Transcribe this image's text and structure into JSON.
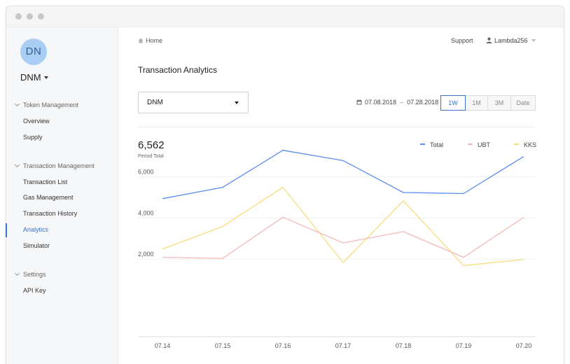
{
  "sidebar": {
    "avatar_initials": "DN",
    "org_name": "DNM",
    "sections": [
      {
        "label": "Token Management",
        "items": [
          "Overview",
          "Supply"
        ]
      },
      {
        "label": "Transaction Management",
        "items": [
          "Transaction List",
          "Gas Management",
          "Transaction History",
          "Analytics",
          "Simulator"
        ]
      },
      {
        "label": "Settings",
        "items": [
          "API Key"
        ]
      }
    ],
    "active_item": "Analytics"
  },
  "header": {
    "breadcrumb": "Home",
    "support": "Support",
    "username": "Lambda256"
  },
  "main": {
    "title": "Transaction Analytics",
    "token_select": "DNM",
    "date_start": "07.08.2018",
    "date_sep": "–",
    "date_end": "07.28.2018",
    "range_buttons": [
      "1W",
      "1M",
      "3M",
      "Date"
    ],
    "active_range": "1W",
    "period_total": "6,562",
    "period_total_label": "Period Total"
  },
  "colors": {
    "accent": "#3b72c9",
    "total": "#5b8def",
    "ubt": "#f3b9b9",
    "kks": "#f8dc7a"
  },
  "chart_data": {
    "type": "line",
    "x": [
      "07.14",
      "07.15",
      "07.16",
      "07.17",
      "07.18",
      "07.19",
      "07.20"
    ],
    "y_ticks": [
      "2,000",
      "4,000",
      "6,000"
    ],
    "ylim": [
      0,
      8000
    ],
    "grid": true,
    "legend_position": "top-right",
    "series": [
      {
        "name": "Total",
        "color": "#5b8def",
        "values": [
          4700,
          5250,
          7050,
          6550,
          5000,
          4950,
          6750
        ]
      },
      {
        "name": "UBT",
        "color": "#f3b9b9",
        "values": [
          1850,
          1800,
          3800,
          2550,
          3100,
          1850,
          3800
        ]
      },
      {
        "name": "KKS",
        "color": "#f8dc7a",
        "values": [
          2250,
          3350,
          5250,
          1600,
          4600,
          1450,
          1750
        ]
      }
    ]
  }
}
